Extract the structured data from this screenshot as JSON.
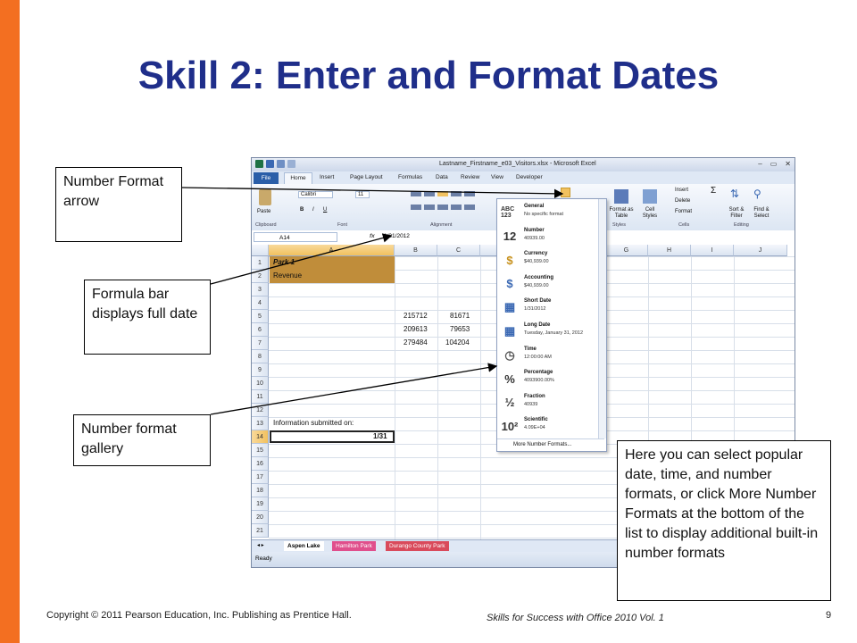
{
  "slide": {
    "title": "Skill 2: Enter and Format Dates",
    "footer_copyright": "Copyright © 2011 Pearson Education, Inc. Publishing as Prentice Hall.",
    "footer_book": "Skills for Success with Office 2010 Vol. 1",
    "page_number": "9",
    "accent_color": "#f36f21",
    "title_color": "#1f2e8a"
  },
  "callouts": {
    "number_format_arrow": "Number Format arrow",
    "formula_bar": "Formula bar displays full date",
    "gallery": "Number format gallery",
    "tip": "Here you can select popular date, time, and number formats, or click More Number Formats at the bottom of the list to display additional built-in number formats"
  },
  "excel": {
    "window_title": "Lastname_Firstname_e03_Visitors.xlsx - Microsoft Excel",
    "tabs": [
      "File",
      "Home",
      "Insert",
      "Page Layout",
      "Formulas",
      "Data",
      "Review",
      "View",
      "Developer"
    ],
    "ribbon": {
      "paste": "Paste",
      "font_name": "Calibri",
      "font_size": "11",
      "bold": "B",
      "italic": "I",
      "underline": "U",
      "format_as_table": "Format as Table",
      "cell_styles": "Cell Styles",
      "insert": "Insert",
      "delete": "Delete",
      "format": "Format",
      "sort_filter": "Sort & Filter",
      "find_select": "Find & Select",
      "groups": [
        "Clipboard",
        "Font",
        "Alignment",
        "Styles",
        "Cells",
        "Editing"
      ]
    },
    "name_box": "A14",
    "fx": "fx",
    "formula_value": "1/31/2012",
    "columns": [
      "A",
      "B",
      "C",
      "G",
      "H",
      "I",
      "J"
    ],
    "rows": [
      "1",
      "2",
      "3",
      "4",
      "5",
      "6",
      "7",
      "8",
      "9",
      "10",
      "11",
      "12",
      "13",
      "14",
      "15",
      "16",
      "17",
      "18",
      "19",
      "20",
      "21"
    ],
    "cells": {
      "a1": "Park 1",
      "a2": "Revenue",
      "b5": "215712",
      "c5": "81671",
      "b6": "209613",
      "c6": "79653",
      "b7": "279484",
      "c7": "104204",
      "a13": "Information submitted on:",
      "a14": "1/31"
    },
    "sheet_tabs": [
      "Aspen Lake",
      "Hamilton Park",
      "Durango County Park"
    ],
    "status": "Ready"
  },
  "gallery": {
    "items": [
      {
        "icon": "ABC 123",
        "name": "General",
        "sample": "No specific format"
      },
      {
        "icon": "12",
        "name": "Number",
        "sample": "40939.00"
      },
      {
        "icon": "$",
        "name": "Currency",
        "sample": "$40,939.00"
      },
      {
        "icon": "$",
        "name": "Accounting",
        "sample": "$40,939.00"
      },
      {
        "icon": "▦",
        "name": "Short Date",
        "sample": "1/31/2012"
      },
      {
        "icon": "▦",
        "name": "Long Date",
        "sample": "Tuesday, January 31, 2012"
      },
      {
        "icon": "◷",
        "name": "Time",
        "sample": "12:00:00 AM"
      },
      {
        "icon": "%",
        "name": "Percentage",
        "sample": "4093900.00%"
      },
      {
        "icon": "½",
        "name": "Fraction",
        "sample": "40939"
      },
      {
        "icon": "10²",
        "name": "Scientific",
        "sample": "4.09E+04"
      }
    ],
    "more": "More Number Formats..."
  }
}
